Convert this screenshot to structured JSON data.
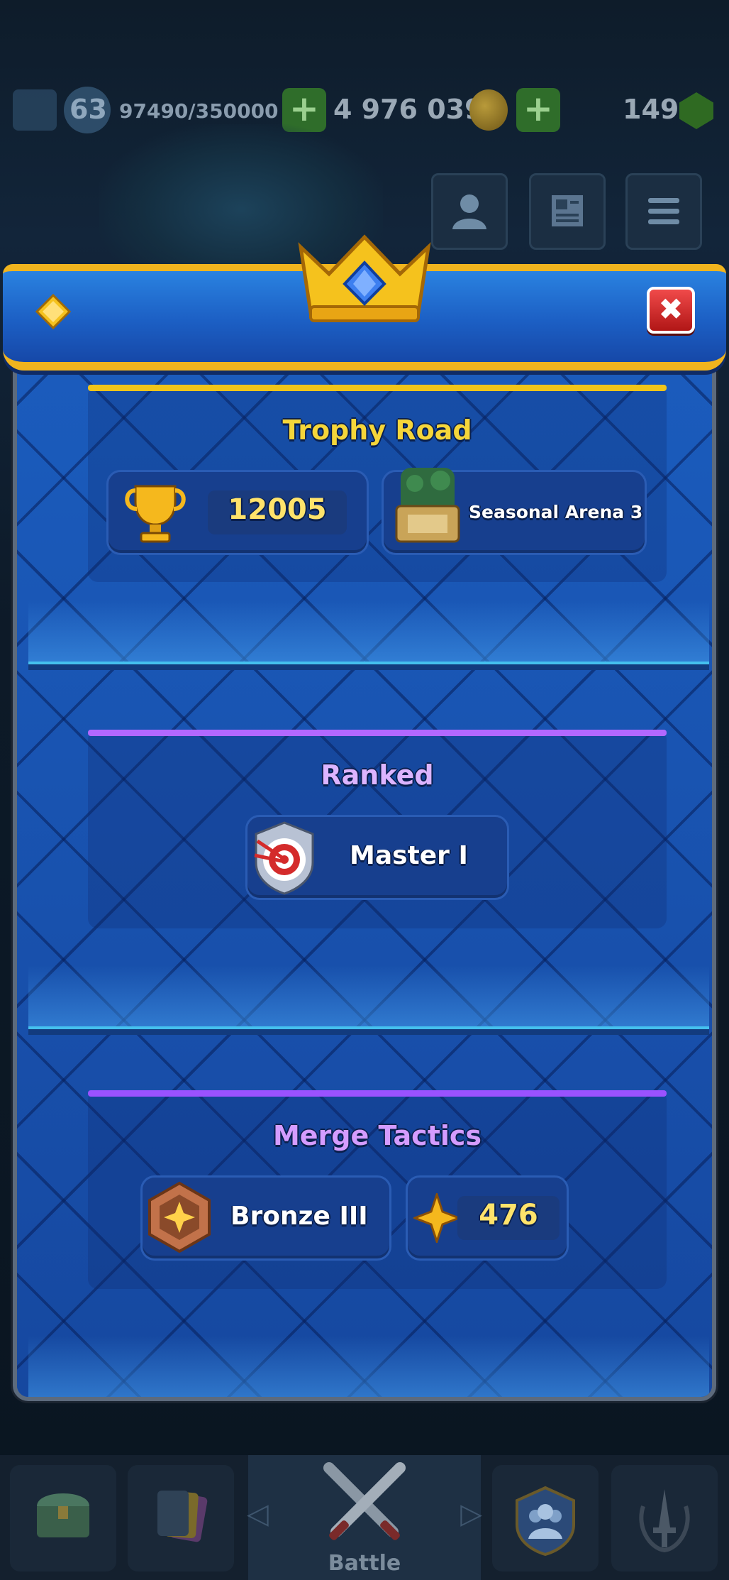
{
  "status_bar": {
    "level": "63",
    "xp": "97490/350000",
    "gold": "4 976 039",
    "gems": "149",
    "plus_symbol": "+"
  },
  "modal": {
    "close_symbol": "✖",
    "sections": {
      "trophy_road": {
        "title": "Trophy Road",
        "trophies": "12005",
        "arena": "Seasonal Arena 3",
        "title_color": "#f5d63a",
        "stripe_color": "#f0c419"
      },
      "ranked": {
        "title": "Ranked",
        "league": "Master I",
        "title_color": "#dcb4ff",
        "stripe_color": "#b268ff"
      },
      "merge_tactics": {
        "title": "Merge Tactics",
        "league": "Bronze III",
        "points": "476",
        "title_color": "#d49cff",
        "stripe_color": "#9a52ff"
      }
    }
  },
  "nav": {
    "battle_label": "Battle",
    "prev_arrow": "◁",
    "next_arrow": "▷"
  },
  "icons": [
    "crown-icon",
    "gem-icon",
    "trophy-icon",
    "arena-icon",
    "ranked-target-icon",
    "bronze-badge-icon",
    "star-icon",
    "profile-icon",
    "news-icon",
    "menu-icon",
    "chest-icon",
    "cards-icon",
    "battle-swords-icon",
    "clan-icon",
    "events-icon"
  ]
}
